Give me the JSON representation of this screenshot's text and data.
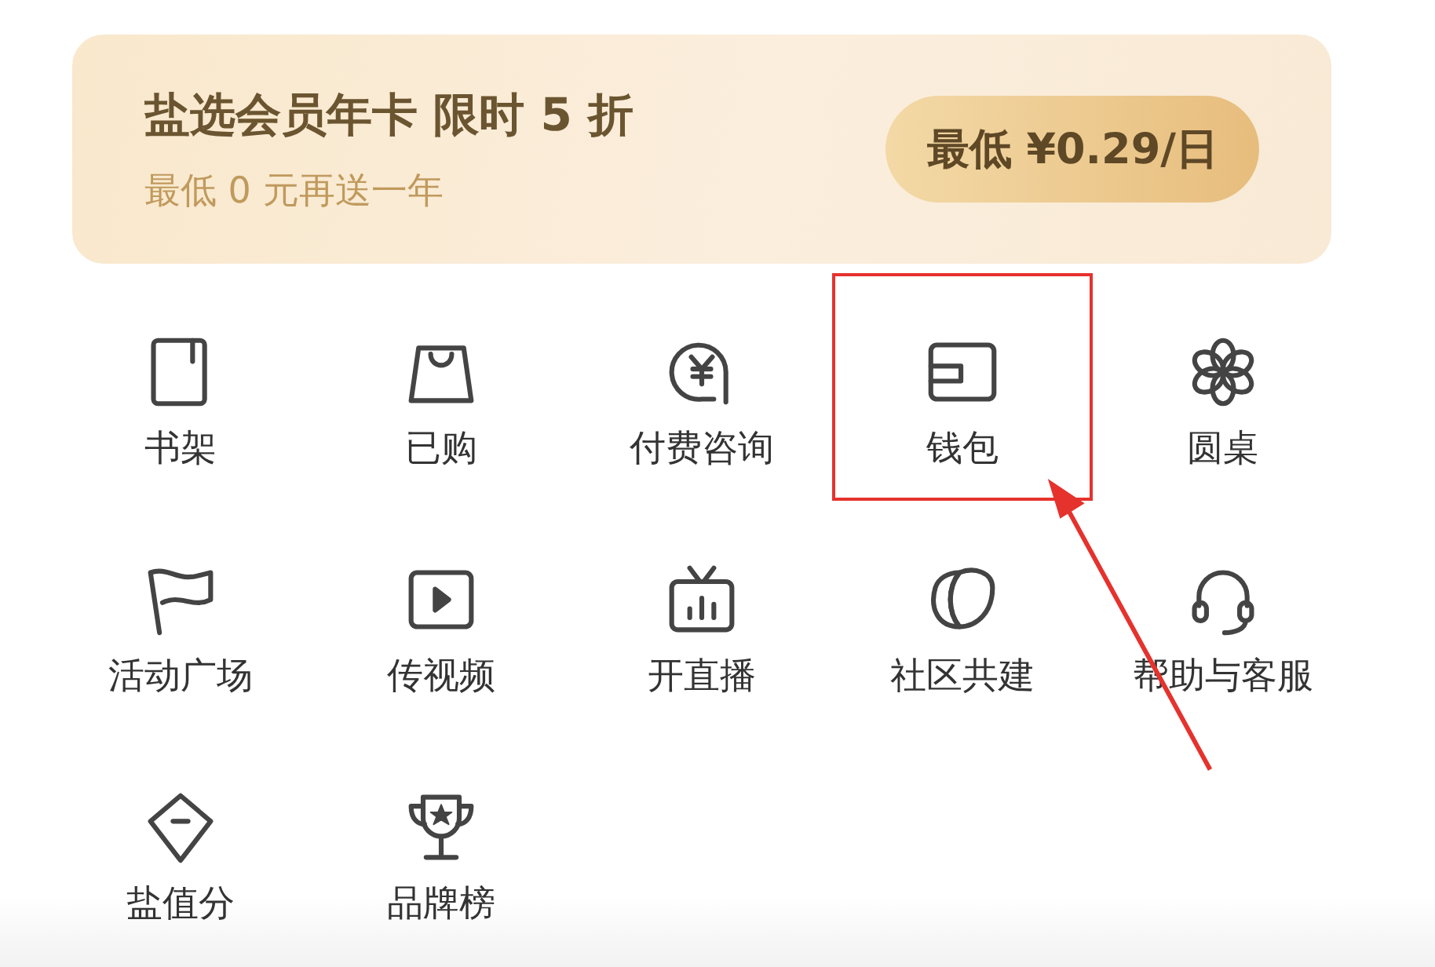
{
  "banner": {
    "title": "盐选会员年卡 限时 5 折",
    "subtitle": "最低 0 元再送一年",
    "button": "最低 ¥0.29/日"
  },
  "items": [
    {
      "label": "书架",
      "kind": "shelf",
      "highlighted": false
    },
    {
      "label": "已购",
      "kind": "bag",
      "highlighted": false
    },
    {
      "label": "付费咨询",
      "kind": "consult",
      "highlighted": false
    },
    {
      "label": "钱包",
      "kind": "wallet",
      "highlighted": true
    },
    {
      "label": "圆桌",
      "kind": "flower",
      "highlighted": false
    },
    {
      "label": "活动广场",
      "kind": "flag",
      "highlighted": false
    },
    {
      "label": "传视频",
      "kind": "video",
      "highlighted": false
    },
    {
      "label": "开直播",
      "kind": "tv",
      "highlighted": false
    },
    {
      "label": "社区共建",
      "kind": "leaves",
      "highlighted": false
    },
    {
      "label": "帮助与客服",
      "kind": "headset",
      "highlighted": false
    },
    {
      "label": "盐值分",
      "kind": "kite",
      "highlighted": false
    },
    {
      "label": "品牌榜",
      "kind": "trophy",
      "highlighted": false
    }
  ]
}
